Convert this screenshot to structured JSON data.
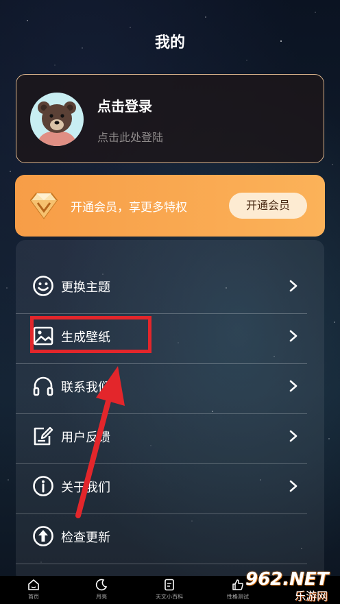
{
  "header": {
    "title": "我的"
  },
  "login": {
    "title": "点击登录",
    "subtitle": "点击此处登陆"
  },
  "vip": {
    "text": "开通会员，享更多特权",
    "button": "开通会员"
  },
  "menu": {
    "items": [
      {
        "label": "更换主题",
        "icon": "smiley-icon"
      },
      {
        "label": "生成壁纸",
        "icon": "image-icon"
      },
      {
        "label": "联系我们",
        "icon": "headphones-icon"
      },
      {
        "label": "用户反馈",
        "icon": "feedback-edit-icon"
      },
      {
        "label": "关于我们",
        "icon": "info-icon"
      },
      {
        "label": "检查更新",
        "icon": "upload-icon"
      }
    ]
  },
  "tabbar": {
    "tabs": [
      {
        "label": "首页",
        "icon": "home-icon"
      },
      {
        "label": "月亮",
        "icon": "moon-icon"
      },
      {
        "label": "天文小百科",
        "icon": "book-icon"
      },
      {
        "label": "性格测试",
        "icon": "thumbs-up-icon"
      }
    ]
  },
  "watermark": {
    "logo": "962.NET",
    "sub": "乐游网"
  },
  "colors": {
    "accent_orange": "#f79d47",
    "highlight_red": "#e3262b",
    "border_gold": "#d9b48d"
  }
}
